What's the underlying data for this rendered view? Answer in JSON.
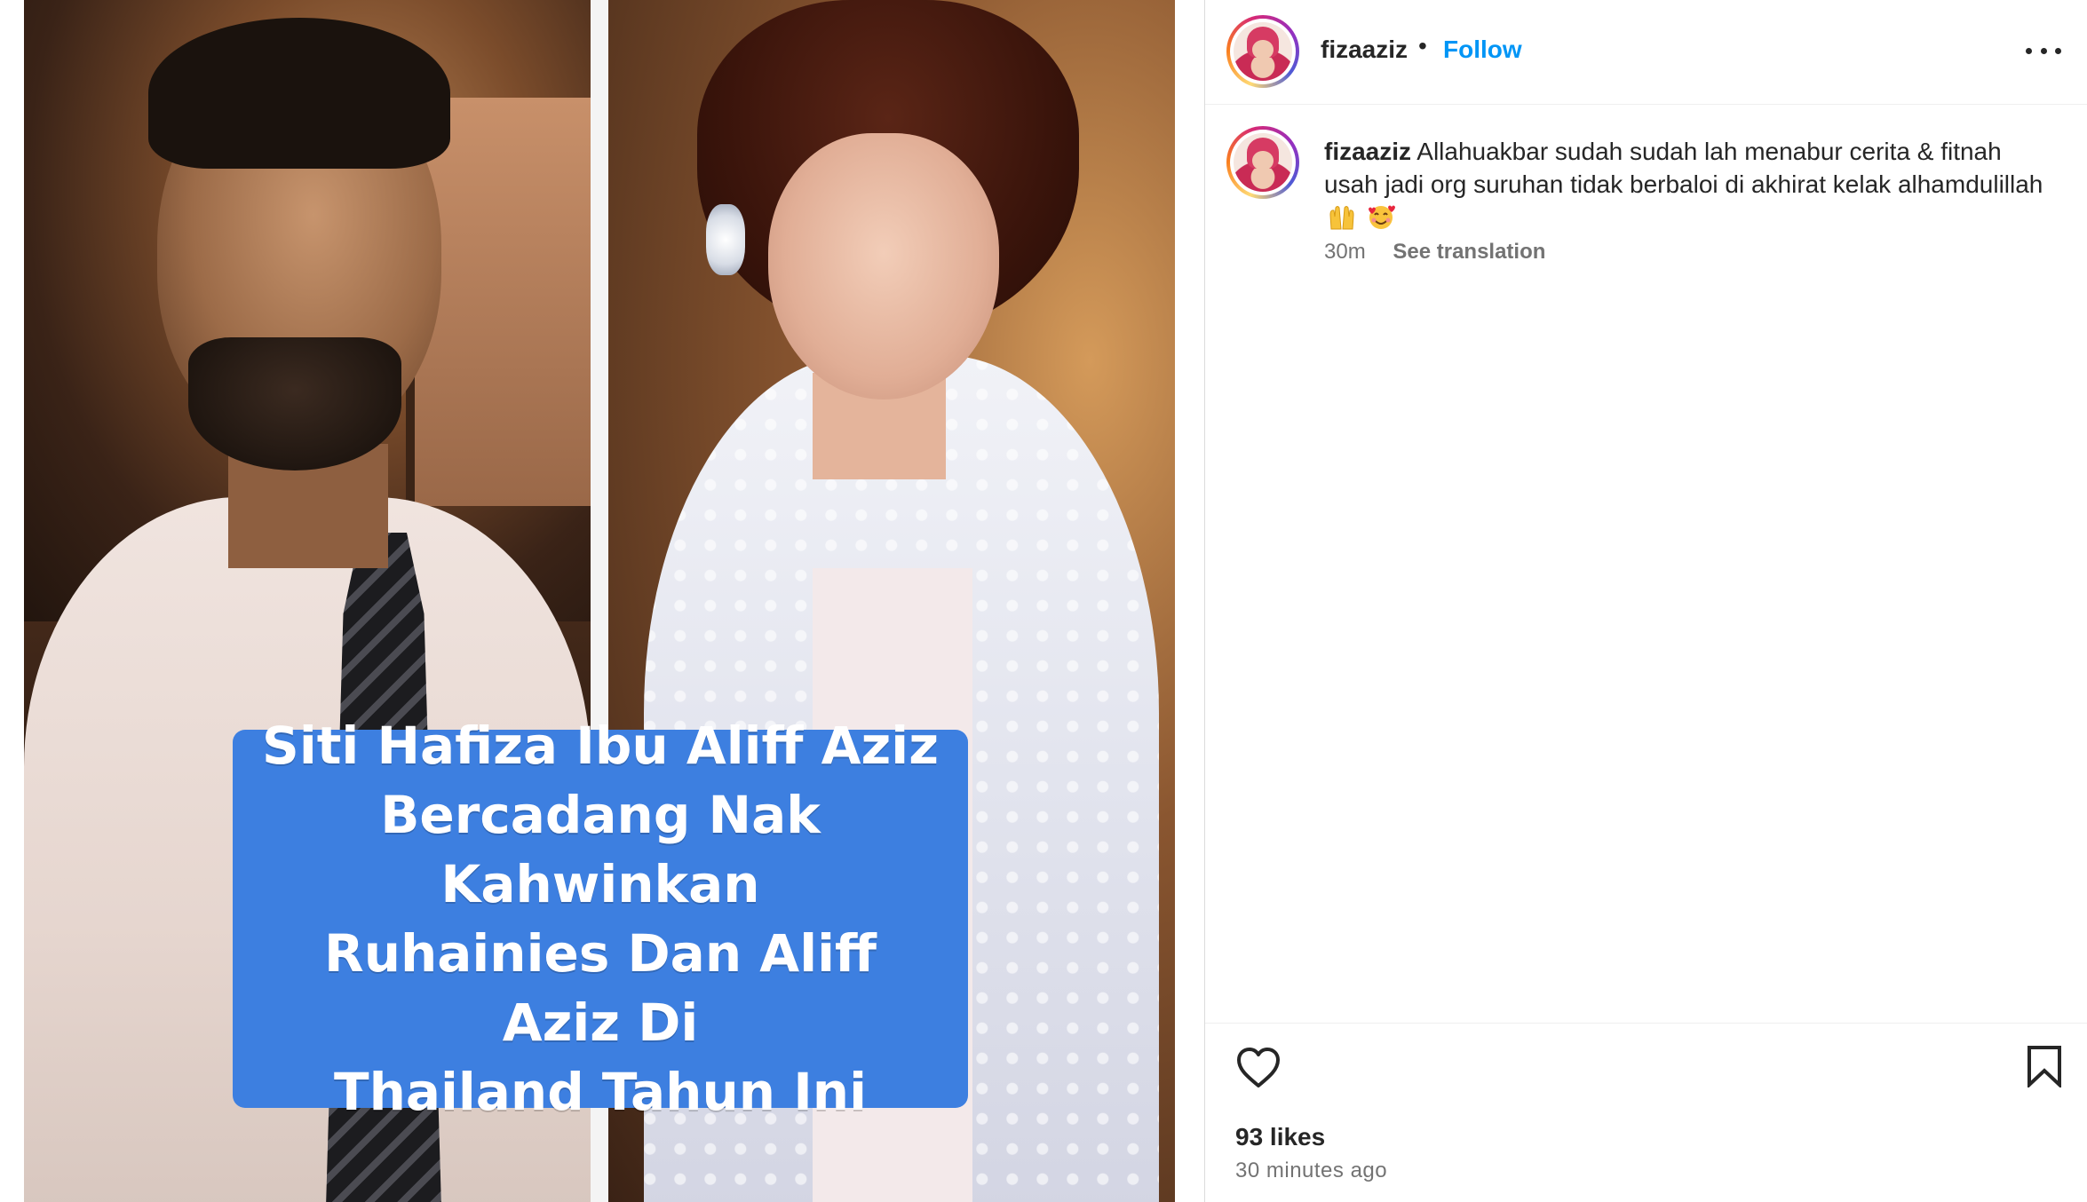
{
  "media": {
    "caption_lines": [
      "Siti Hafiza Ibu Aliff Aziz",
      "Bercadang Nak Kahwinkan",
      "Ruhainies Dan Aliff Aziz Di",
      "Thailand Tahun Ini"
    ],
    "caption_color": "#3d7fe0"
  },
  "header": {
    "username": "fizaaziz",
    "separator": "•",
    "follow_label": "Follow",
    "more_icon": "more-horizontal-icon"
  },
  "comment": {
    "username": "fizaaziz",
    "text": "Allahuakbar sudah sudah lah menabur cerita & fitnah usah jadi org suruhan tidak berbaloi di akhirat kelak alhamdulillah",
    "emojis": [
      "raising-hands-emoji",
      "smiling-face-with-hearts-emoji"
    ],
    "time": "30m",
    "translate_label": "See translation"
  },
  "actions": {
    "like_icon": "heart-icon",
    "save_icon": "bookmark-icon",
    "likes": "93 likes",
    "posted": "30 minutes ago"
  },
  "colors": {
    "link": "#0095f6",
    "text": "#262626",
    "muted": "#737373"
  }
}
